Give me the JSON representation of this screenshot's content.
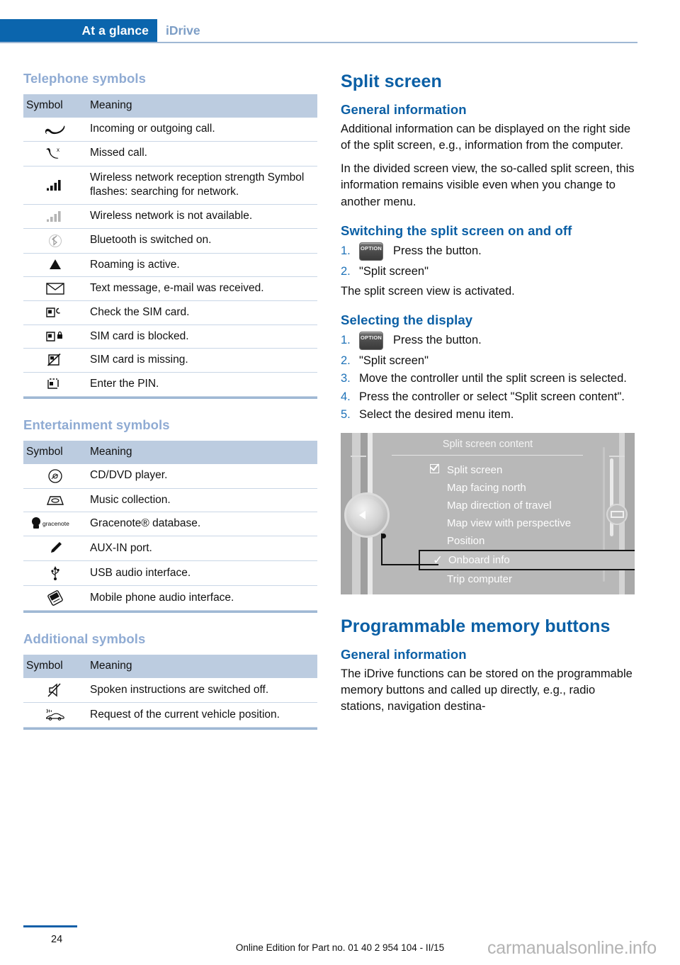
{
  "header": {
    "active_tab": "At a glance",
    "inactive_tab": "iDrive",
    "accent_blue": "#0b65ad",
    "inactive_blue": "#7d9ec6"
  },
  "left_column": {
    "telephone": {
      "heading": "Telephone symbols",
      "columns": [
        "Symbol",
        "Meaning"
      ],
      "rows": [
        {
          "icon": "phone-handset-icon",
          "meaning": "Incoming or outgoing call."
        },
        {
          "icon": "missed-call-icon",
          "meaning": "Missed call."
        },
        {
          "icon": "signal-strength-full-icon",
          "meaning": "Wireless network reception strength Symbol flashes: searching for network."
        },
        {
          "icon": "signal-strength-empty-icon",
          "meaning": "Wireless network is not available."
        },
        {
          "icon": "bluetooth-icon",
          "meaning": "Bluetooth is switched on."
        },
        {
          "icon": "roaming-triangle-icon",
          "meaning": "Roaming is active."
        },
        {
          "icon": "envelope-icon",
          "meaning": "Text message, e-mail was received."
        },
        {
          "icon": "sim-check-icon",
          "meaning": "Check the SIM card."
        },
        {
          "icon": "sim-locked-icon",
          "meaning": "SIM card is blocked."
        },
        {
          "icon": "sim-missing-icon",
          "meaning": "SIM card is missing."
        },
        {
          "icon": "sim-pin-icon",
          "meaning": "Enter the PIN."
        }
      ]
    },
    "entertainment": {
      "heading": "Entertainment symbols",
      "columns": [
        "Symbol",
        "Meaning"
      ],
      "rows": [
        {
          "icon": "cd-dvd-disc-icon",
          "meaning": "CD/DVD player."
        },
        {
          "icon": "music-collection-drive-icon",
          "meaning": "Music collection."
        },
        {
          "icon": "gracenote-logo-icon",
          "meaning": "Gracenote® database."
        },
        {
          "icon": "aux-in-plug-icon",
          "meaning": "AUX-IN port."
        },
        {
          "icon": "usb-icon",
          "meaning": "USB audio interface."
        },
        {
          "icon": "mobile-phone-audio-icon",
          "meaning": "Mobile phone audio interface."
        }
      ]
    },
    "additional": {
      "heading": "Additional symbols",
      "columns": [
        "Symbol",
        "Meaning"
      ],
      "rows": [
        {
          "icon": "speaker-muted-icon",
          "meaning": "Spoken instructions are switched off."
        },
        {
          "icon": "vehicle-position-icon",
          "meaning": "Request of the current vehicle position."
        }
      ]
    }
  },
  "right_column": {
    "split_screen": {
      "title": "Split screen",
      "general": {
        "heading": "General information",
        "paragraphs": [
          "Additional information can be displayed on the right side of the split screen, e.g., information from the computer.",
          "In the divided screen view, the so-called split screen, this information remains visible even when you change to another menu."
        ]
      },
      "switching": {
        "heading": "Switching the split screen on and off",
        "steps": [
          {
            "num": "1.",
            "button": "OPTION",
            "text": "Press the button."
          },
          {
            "num": "2.",
            "text": "\"Split screen\""
          }
        ],
        "note": "The split screen view is activated."
      },
      "selecting": {
        "heading": "Selecting the display",
        "steps": [
          {
            "num": "1.",
            "button": "OPTION",
            "text": "Press the button."
          },
          {
            "num": "2.",
            "text": "\"Split screen\""
          },
          {
            "num": "3.",
            "text": "Move the controller until the split screen is selected."
          },
          {
            "num": "4.",
            "text": "Press the controller or select \"Split screen content\"."
          },
          {
            "num": "5.",
            "text": "Select the desired menu item."
          }
        ]
      },
      "figure": {
        "title": "Split screen content",
        "items": [
          {
            "label": "Split screen",
            "state": "checkbox-checked",
            "selected": false
          },
          {
            "label": "Map facing north",
            "state": "none",
            "selected": false
          },
          {
            "label": "Map direction of travel",
            "state": "none",
            "selected": false
          },
          {
            "label": "Map view with perspective",
            "state": "none",
            "selected": false
          },
          {
            "label": "Position",
            "state": "none",
            "selected": false
          },
          {
            "label": "Onboard info",
            "state": "check",
            "selected": true
          },
          {
            "label": "Trip computer",
            "state": "none",
            "selected": false
          }
        ]
      }
    },
    "memory_buttons": {
      "title": "Programmable memory buttons",
      "general_heading": "General information",
      "paragraph": "The iDrive functions can be stored on the programmable memory buttons and called up directly, e.g., radio stations, navigation destina-"
    }
  },
  "footer": {
    "page_number": "24",
    "edition": "Online Edition for Part no. 01 40 2 954 104 - II/15",
    "watermark": "carmanualsonline.info"
  }
}
